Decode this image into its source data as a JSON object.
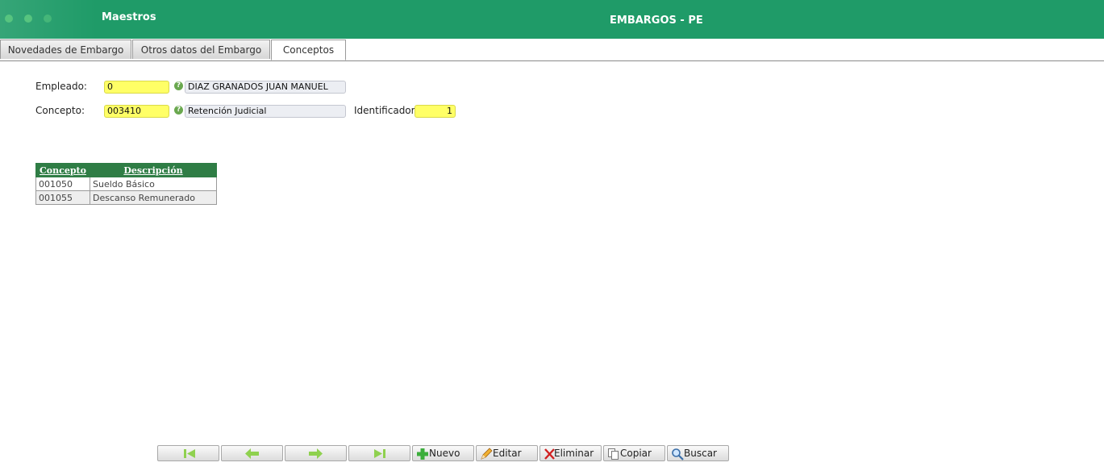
{
  "header": {
    "module": "Maestros",
    "title": "EMBARGOS - PE"
  },
  "tabs": [
    {
      "label": "Novedades de Embargo"
    },
    {
      "label": "Otros datos del Embargo"
    },
    {
      "label": "Conceptos"
    }
  ],
  "form": {
    "empleado_label": "Empleado:",
    "empleado_value": "0",
    "empleado_name": "DIAZ GRANADOS JUAN MANUEL",
    "concepto_label": "Concepto:",
    "concepto_value": "003410",
    "concepto_name": "Retención Judicial",
    "identificador_label": "Identificador:",
    "identificador_value": "1",
    "help_symbol": "?"
  },
  "grid": {
    "columns": [
      "Concepto",
      "Descripción"
    ],
    "rows": [
      {
        "concepto": "001050",
        "descripcion": "Sueldo Básico"
      },
      {
        "concepto": "001055",
        "descripcion": "Descanso Remunerado"
      }
    ]
  },
  "toolbar": {
    "nuevo": "Nuevo",
    "editar": "Editar",
    "eliminar": "Eliminar",
    "copiar": "Copiar",
    "buscar": "Buscar"
  },
  "icons": {
    "first": "first-record-icon",
    "prev": "previous-record-icon",
    "next": "next-record-icon",
    "last": "last-record-icon"
  },
  "colors": {
    "header": "#1f9b68",
    "grid_header": "#2f7d45",
    "required_field": "#ffff66"
  }
}
